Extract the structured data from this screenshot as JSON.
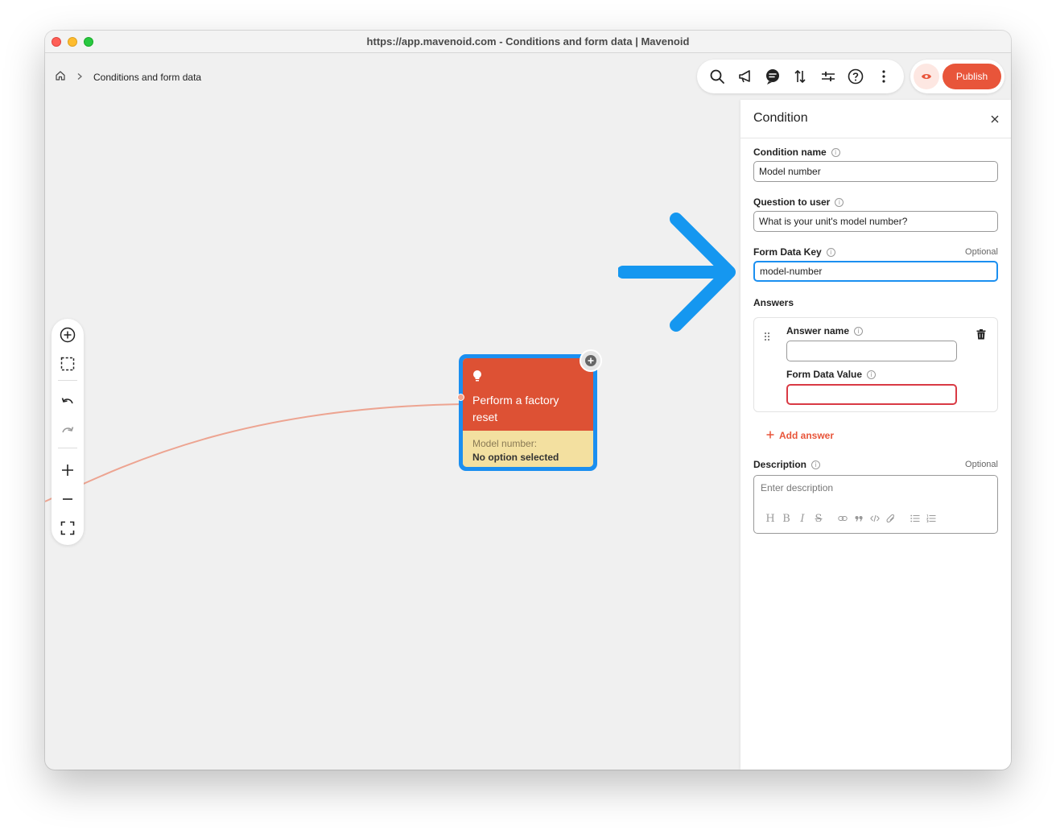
{
  "window": {
    "title": "https://app.mavenoid.com - Conditions and form data | Mavenoid"
  },
  "breadcrumb": {
    "home_icon": "home-icon",
    "separator_icon": "chevron-right-icon",
    "current": "Conditions and form data"
  },
  "toolbar": {
    "icons": [
      "search-icon",
      "megaphone-icon",
      "chat-icon",
      "sort-arrows-icon",
      "sliders-icon",
      "help-icon",
      "more-vertical-icon"
    ],
    "preview_icon": "eye-icon",
    "publish_label": "Publish"
  },
  "canvas_tools": {
    "icons": [
      "add-circle-icon",
      "select-area-icon",
      "undo-icon",
      "redo-icon",
      "zoom-in-icon",
      "zoom-out-icon",
      "fit-screen-icon"
    ]
  },
  "node": {
    "icon": "lightbulb-icon",
    "title": "Perform a factory reset",
    "condition_label": "Model number:",
    "condition_value": "No option selected",
    "add_icon": "add-node-icon"
  },
  "annotation": {
    "arrow_color": "#1597f0"
  },
  "panel": {
    "title": "Condition",
    "close_icon": "close-icon",
    "condition_name": {
      "label": "Condition name",
      "value": "Model number"
    },
    "question": {
      "label": "Question to user",
      "value": "What is your unit's model number?"
    },
    "form_data_key": {
      "label": "Form Data Key",
      "optional": "Optional",
      "value": "model-number"
    },
    "answers": {
      "label": "Answers",
      "answer_name_label": "Answer name",
      "answer_name_value": "",
      "form_data_value_label": "Form Data Value",
      "form_data_value_value": "",
      "add_label": "Add answer"
    },
    "description": {
      "label": "Description",
      "optional": "Optional",
      "placeholder": "Enter description",
      "format_buttons": [
        "H",
        "B",
        "I",
        "S",
        "link",
        "quote",
        "code",
        "attach",
        "bullet-list",
        "numbered-list"
      ]
    }
  },
  "colors": {
    "accent": "#e8553a",
    "focus": "#1b8ff0",
    "error": "#d93a44",
    "node_header": "#dd5134",
    "node_footer": "#f3e0a0"
  }
}
